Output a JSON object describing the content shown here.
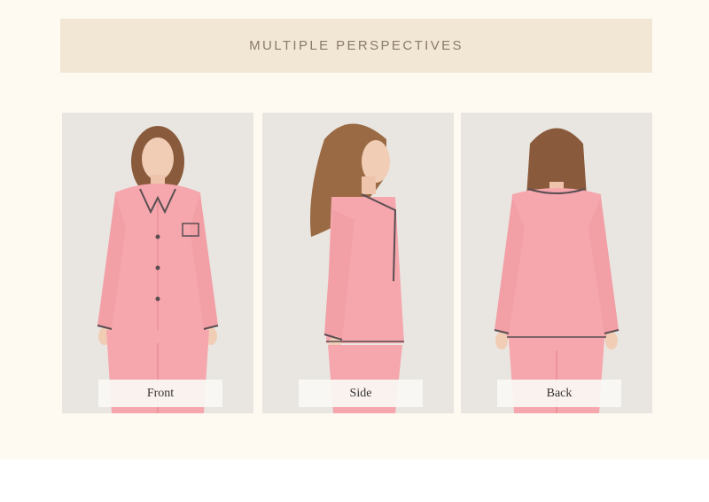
{
  "header": {
    "title": "MULTIPLE PERSPECTIVES"
  },
  "panels": [
    {
      "caption": "Front"
    },
    {
      "caption": "Side"
    },
    {
      "caption": "Back"
    }
  ],
  "colors": {
    "background": "#fefaf1",
    "header_band": "#f2e6d5",
    "header_text": "#8a7b6a",
    "garment_pink": "#f5a7ad",
    "piping": "#5a4e52"
  }
}
